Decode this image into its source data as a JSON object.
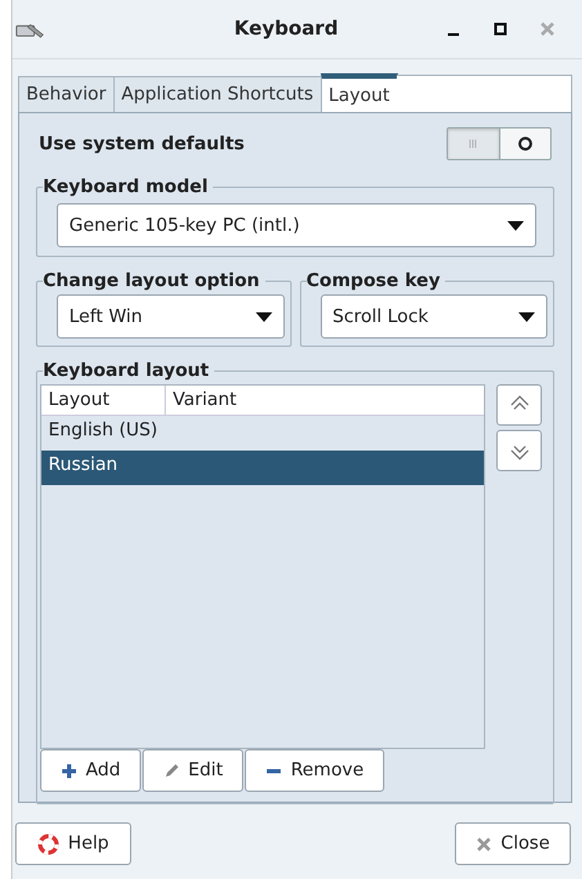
{
  "window": {
    "title": "Keyboard"
  },
  "tabs": [
    {
      "label": "Behavior",
      "selected": false
    },
    {
      "label": "Application Shortcuts",
      "selected": false
    },
    {
      "label": "Layout",
      "selected": true
    }
  ],
  "use_system_defaults": {
    "label": "Use system defaults",
    "on": false
  },
  "keyboard_model": {
    "title": "Keyboard model",
    "value": "Generic 105-key PC (intl.)"
  },
  "change_layout_option": {
    "title": "Change layout option",
    "value": "Left Win"
  },
  "compose_key": {
    "title": "Compose key",
    "value": "Scroll Lock"
  },
  "keyboard_layout": {
    "title": "Keyboard layout",
    "columns": [
      "Layout",
      "Variant"
    ],
    "rows": [
      {
        "layout": "English (US)",
        "selected": false
      },
      {
        "layout": "Russian",
        "selected": true
      }
    ],
    "buttons": [
      {
        "kind": "add",
        "label": "Add"
      },
      {
        "kind": "edit",
        "label": "Edit"
      },
      {
        "kind": "remove",
        "label": "Remove"
      }
    ]
  },
  "footer_buttons": [
    {
      "kind": "help",
      "label": "Help"
    },
    {
      "kind": "close",
      "label": "Close"
    }
  ]
}
